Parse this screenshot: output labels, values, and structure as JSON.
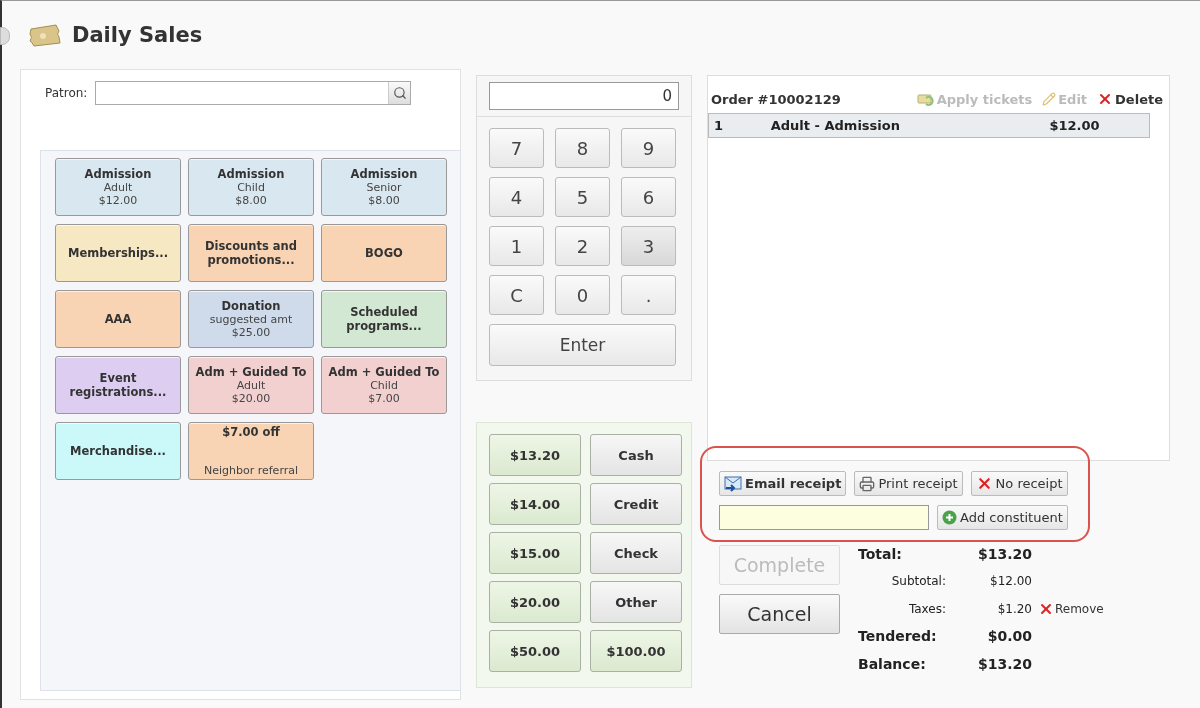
{
  "window": {
    "title": "Daily Sales"
  },
  "patron": {
    "label": "Patron:"
  },
  "tiles": [
    {
      "title": "Admission",
      "lines": [
        "Adult",
        "$12.00"
      ],
      "color": "#d9e8f0"
    },
    {
      "title": "Admission",
      "lines": [
        "Child",
        "$8.00"
      ],
      "color": "#d9e8f0"
    },
    {
      "title": "Admission",
      "lines": [
        "Senior",
        "$8.00"
      ],
      "color": "#d9e8f0"
    },
    {
      "title": "Memberships...",
      "color": "#f7e8c4"
    },
    {
      "title": "Discounts and promotions...",
      "color": "#f9d4b4"
    },
    {
      "title": "BOGO",
      "color": "#f9d4b4"
    },
    {
      "title": "AAA",
      "color": "#f9d4b4"
    },
    {
      "title": "Donation",
      "lines": [
        "suggested amt",
        "$25.00"
      ],
      "color": "#cfdbea"
    },
    {
      "title": "Scheduled programs...",
      "color": "#d3e8d2"
    },
    {
      "title": "Event registrations...",
      "color": "#dccdf1"
    },
    {
      "title": "Adm + Guided To",
      "lines": [
        "Adult",
        "$20.00"
      ],
      "color": "#f3d0d0"
    },
    {
      "title": "Adm + Guided To",
      "lines": [
        "Child",
        "$7.00"
      ],
      "color": "#f3d0d0"
    },
    {
      "title": "Merchandise...",
      "color": "#cbf8f9"
    },
    {
      "title": "$7.00 off",
      "footnote": "Neighbor referral",
      "color": "#f9d4b4"
    }
  ],
  "keypad": {
    "display": "0",
    "keys": [
      {
        "label": "7",
        "highlighted": false
      },
      {
        "label": "8",
        "highlighted": false
      },
      {
        "label": "9",
        "highlighted": false
      },
      {
        "label": "4",
        "highlighted": false
      },
      {
        "label": "5",
        "highlighted": false
      },
      {
        "label": "6",
        "highlighted": false
      },
      {
        "label": "1",
        "highlighted": false
      },
      {
        "label": "2",
        "highlighted": false
      },
      {
        "label": "3",
        "highlighted": true
      },
      {
        "label": "C",
        "highlighted": false
      },
      {
        "label": "0",
        "highlighted": false
      },
      {
        "label": ".",
        "highlighted": false
      }
    ],
    "enter": "Enter"
  },
  "payment_buttons": [
    {
      "label": "$13.20",
      "kind": "amount"
    },
    {
      "label": "Cash",
      "kind": "method"
    },
    {
      "label": "$14.00",
      "kind": "amount"
    },
    {
      "label": "Credit",
      "kind": "method"
    },
    {
      "label": "$15.00",
      "kind": "amount"
    },
    {
      "label": "Check",
      "kind": "method"
    },
    {
      "label": "$20.00",
      "kind": "amount"
    },
    {
      "label": "Other",
      "kind": "method"
    },
    {
      "label": "$50.00",
      "kind": "amount"
    },
    {
      "label": "$100.00",
      "kind": "amount"
    }
  ],
  "order": {
    "title": "Order #10002129",
    "actions": [
      {
        "label": "Apply tickets",
        "kind": "apply",
        "disabled": true
      },
      {
        "label": "Edit",
        "kind": "edit",
        "disabled": true
      },
      {
        "label": "Delete",
        "kind": "delete",
        "disabled": false
      }
    ],
    "items": [
      {
        "qty": "1",
        "name": "Adult - Admission",
        "price": "$12.00",
        "selected": true
      }
    ]
  },
  "receipt": {
    "buttons": [
      {
        "label": "Email receipt",
        "kind": "email",
        "selected": true
      },
      {
        "label": "Print receipt",
        "kind": "print",
        "selected": false
      },
      {
        "label": "No receipt",
        "kind": "none",
        "selected": false
      }
    ],
    "add_constituent": "Add constituent"
  },
  "actions": [
    {
      "label": "Complete",
      "disabled": true
    },
    {
      "label": "Cancel",
      "disabled": false
    }
  ],
  "totals": [
    {
      "label": "Total:",
      "value": "$13.20",
      "kind": "major"
    },
    {
      "label": "Subtotal:",
      "value": "$12.00",
      "kind": "minor"
    },
    {
      "label": "Taxes:",
      "value": "$1.20",
      "kind": "minor",
      "action": "Remove"
    },
    {
      "label": "Tendered:",
      "value": "$0.00",
      "kind": "major"
    },
    {
      "label": "Balance:",
      "value": "$13.20",
      "kind": "major"
    }
  ]
}
